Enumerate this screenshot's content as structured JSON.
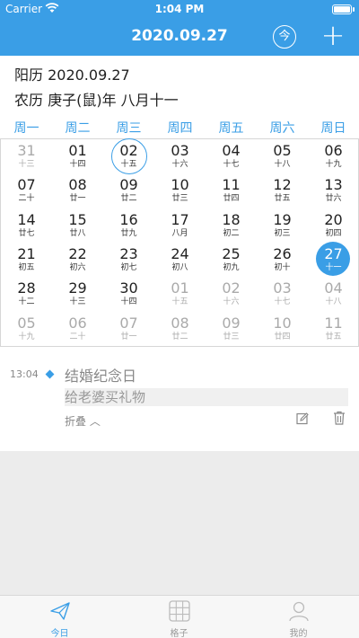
{
  "status": {
    "carrier": "Carrier",
    "time": "1:04 PM"
  },
  "nav": {
    "title": "2020.09.27",
    "today_label": "今",
    "add_label": "+"
  },
  "info": {
    "solar": "阳历 2020.09.27",
    "lunar": "农历 庚子(鼠)年 八月十一"
  },
  "weekdays": [
    "周一",
    "周二",
    "周三",
    "周四",
    "周五",
    "周六",
    "周日"
  ],
  "calendar": [
    [
      [
        "31",
        "十三",
        "other"
      ],
      [
        "01",
        "十四",
        ""
      ],
      [
        "02",
        "十五",
        "selected"
      ],
      [
        "03",
        "十六",
        ""
      ],
      [
        "04",
        "十七",
        ""
      ],
      [
        "05",
        "十八",
        ""
      ],
      [
        "06",
        "十九",
        ""
      ]
    ],
    [
      [
        "07",
        "二十",
        ""
      ],
      [
        "08",
        "廿一",
        ""
      ],
      [
        "09",
        "廿二",
        ""
      ],
      [
        "10",
        "廿三",
        ""
      ],
      [
        "11",
        "廿四",
        ""
      ],
      [
        "12",
        "廿五",
        ""
      ],
      [
        "13",
        "廿六",
        ""
      ]
    ],
    [
      [
        "14",
        "廿七",
        ""
      ],
      [
        "15",
        "廿八",
        ""
      ],
      [
        "16",
        "廿九",
        ""
      ],
      [
        "17",
        "八月",
        ""
      ],
      [
        "18",
        "初二",
        ""
      ],
      [
        "19",
        "初三",
        ""
      ],
      [
        "20",
        "初四",
        ""
      ]
    ],
    [
      [
        "21",
        "初五",
        ""
      ],
      [
        "22",
        "初六",
        ""
      ],
      [
        "23",
        "初七",
        ""
      ],
      [
        "24",
        "初八",
        ""
      ],
      [
        "25",
        "初九",
        ""
      ],
      [
        "26",
        "初十",
        ""
      ],
      [
        "27",
        "十一",
        "today"
      ]
    ],
    [
      [
        "28",
        "十二",
        ""
      ],
      [
        "29",
        "十三",
        ""
      ],
      [
        "30",
        "十四",
        ""
      ],
      [
        "01",
        "十五",
        "other"
      ],
      [
        "02",
        "十六",
        "other"
      ],
      [
        "03",
        "十七",
        "other"
      ],
      [
        "04",
        "十八",
        "other"
      ]
    ],
    [
      [
        "05",
        "十九",
        "other"
      ],
      [
        "06",
        "二十",
        "other"
      ],
      [
        "07",
        "廿一",
        "other"
      ],
      [
        "08",
        "廿二",
        "other"
      ],
      [
        "09",
        "廿三",
        "other"
      ],
      [
        "10",
        "廿四",
        "other"
      ],
      [
        "11",
        "廿五",
        "other"
      ]
    ]
  ],
  "event": {
    "time": "13:04",
    "title": "结婚纪念日",
    "note": "给老婆买礼物",
    "fold": "折叠 ︿"
  },
  "tabs": [
    {
      "label": "今日",
      "icon": "paper-plane-icon"
    },
    {
      "label": "格子",
      "icon": "grid-icon"
    },
    {
      "label": "我的",
      "icon": "user-icon"
    }
  ],
  "colors": {
    "accent": "#3a9ee6"
  }
}
